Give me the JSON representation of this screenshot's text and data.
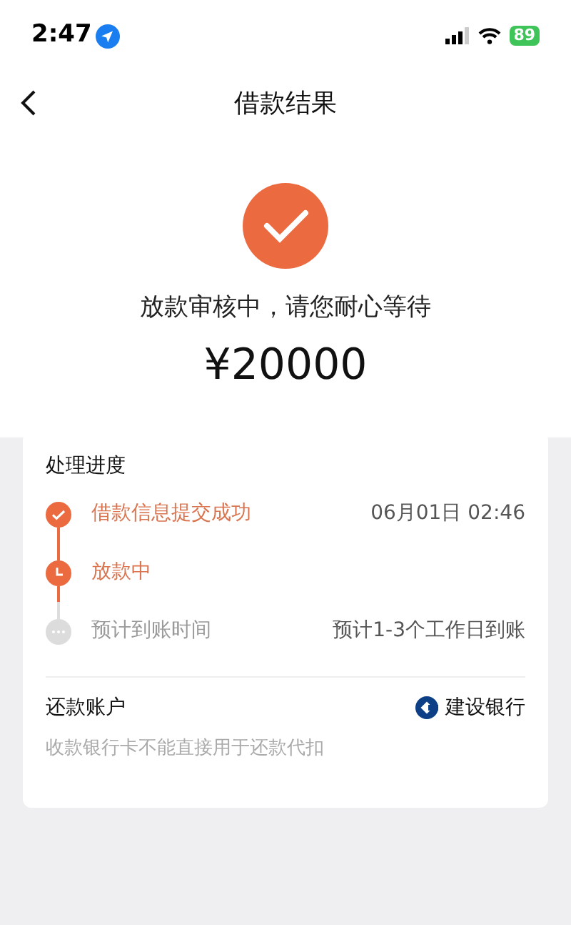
{
  "status_bar": {
    "time": "2:47",
    "battery": "89"
  },
  "nav": {
    "title": "借款结果"
  },
  "result": {
    "message": "放款审核中，请您耐心等待",
    "amount": "¥20000"
  },
  "progress": {
    "title": "处理进度",
    "steps": [
      {
        "label": "借款信息提交成功",
        "detail": "06月01日 02:46",
        "kind": "done"
      },
      {
        "label": "放款中",
        "kind": "active"
      },
      {
        "label": "预计到账时间",
        "detail": "预计1-3个工作日到账",
        "kind": "pending"
      }
    ]
  },
  "account": {
    "label": "还款账户",
    "bank": "建设银行",
    "note": "收款银行卡不能直接用于还款代扣"
  }
}
